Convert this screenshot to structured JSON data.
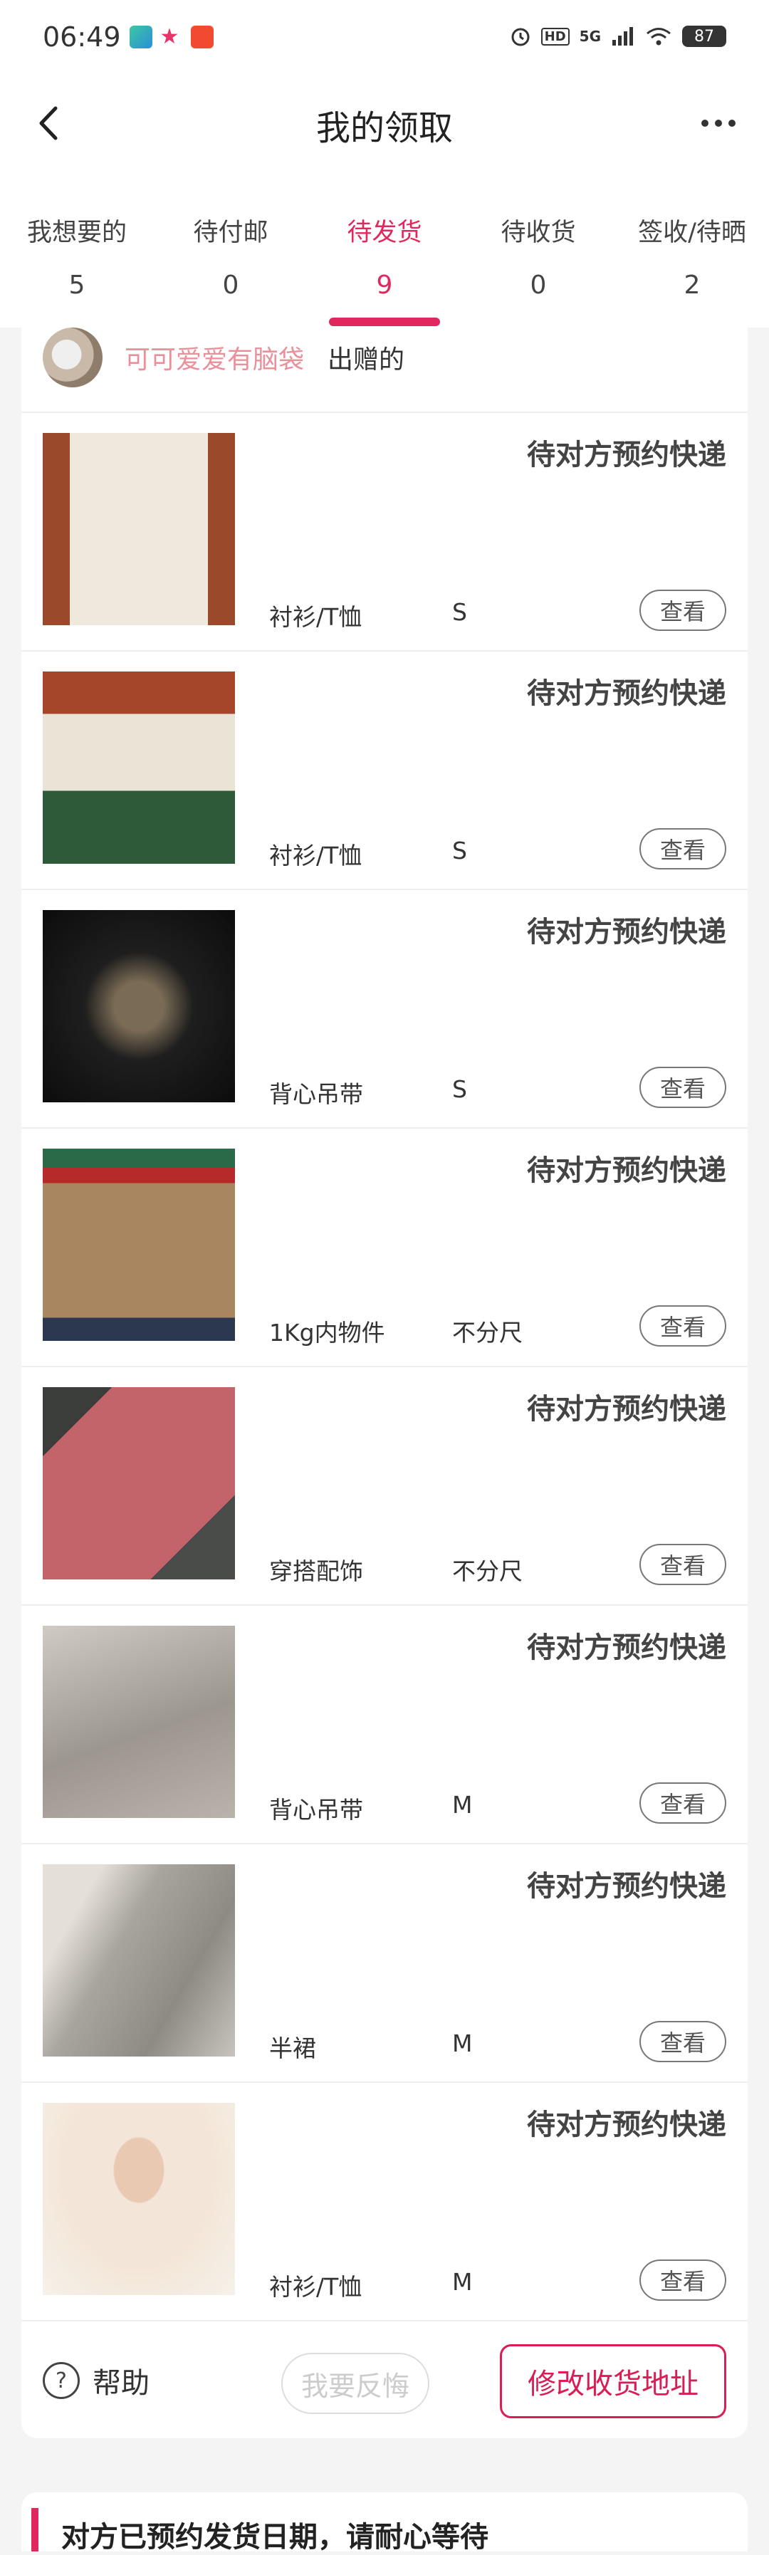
{
  "status_bar": {
    "time": "06:49",
    "network": "5G",
    "battery": "87",
    "hd_label": "HD",
    "icons": [
      "app-notification-icon",
      "star-icon",
      "gift-app-icon",
      "alarm-icon",
      "hd-icon",
      "signal-icon",
      "wifi-icon",
      "battery-icon"
    ]
  },
  "header": {
    "title": "我的领取",
    "back_icon": "chevron-left-icon",
    "more_icon": "more-icon"
  },
  "tabs": [
    {
      "label": "我想要的",
      "count": "5"
    },
    {
      "label": "待付邮",
      "count": "0"
    },
    {
      "label": "待发货",
      "count": "9",
      "active": true
    },
    {
      "label": "待收货",
      "count": "0"
    },
    {
      "label": "签收/待晒",
      "count": "2"
    }
  ],
  "seller": {
    "name": "可可爱爱有脑袋",
    "suffix": "出赠的"
  },
  "items": [
    {
      "status": "待对方预约快递",
      "category": "衬衫/T恤",
      "size": "S",
      "action": "查看"
    },
    {
      "status": "待对方预约快递",
      "category": "衬衫/T恤",
      "size": "S",
      "action": "查看"
    },
    {
      "status": "待对方预约快递",
      "category": "背心吊带",
      "size": "S",
      "action": "查看"
    },
    {
      "status": "待对方预约快递",
      "category": "1Kg内物件",
      "size": "不分尺",
      "action": "查看"
    },
    {
      "status": "待对方预约快递",
      "category": "穿搭配饰",
      "size": "不分尺",
      "action": "查看"
    },
    {
      "status": "待对方预约快递",
      "category": "背心吊带",
      "size": "M",
      "action": "查看"
    },
    {
      "status": "待对方预约快递",
      "category": "半裙",
      "size": "M",
      "action": "查看"
    },
    {
      "status": "待对方预约快递",
      "category": "衬衫/T恤",
      "size": "M",
      "action": "查看"
    }
  ],
  "footer": {
    "help_label": "帮助",
    "help_icon_glyph": "?",
    "feedback_label": "我要反悔",
    "address_label": "修改收货地址"
  },
  "notice": {
    "text": "对方已预约发货日期，请耐心等待"
  },
  "colors": {
    "accent": "#e0285e",
    "seller_name": "#e9909a",
    "background": "#f4f4f4"
  }
}
